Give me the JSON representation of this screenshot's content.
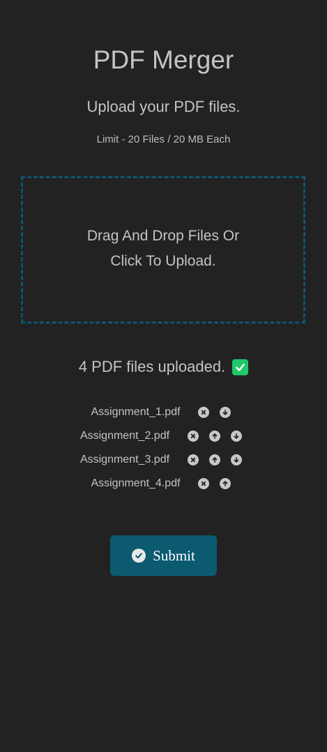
{
  "app": {
    "title": "PDF Merger",
    "subtitle": "Upload your PDF files.",
    "limit": "Limit - 20 Files / 20 MB Each"
  },
  "dropzone": {
    "line1": "Drag And Drop Files Or",
    "line2": "Click To Upload."
  },
  "status": {
    "text": "4 PDF files uploaded.",
    "icon": "check-icon",
    "color": "#1fc96a"
  },
  "files": [
    {
      "name": "Assignment_1.pdf",
      "actions": [
        "remove",
        "move-down"
      ]
    },
    {
      "name": "Assignment_2.pdf",
      "actions": [
        "remove",
        "move-up",
        "move-down"
      ]
    },
    {
      "name": "Assignment_3.pdf",
      "actions": [
        "remove",
        "move-up",
        "move-down"
      ]
    },
    {
      "name": "Assignment_4.pdf",
      "actions": [
        "remove",
        "move-up"
      ]
    }
  ],
  "submit": {
    "label": "Submit",
    "icon": "check-circle-icon",
    "color": "#0b5a70"
  },
  "colors": {
    "background": "#222222",
    "dropzone_border": "#0d5670",
    "text": "#c4c4c4"
  }
}
